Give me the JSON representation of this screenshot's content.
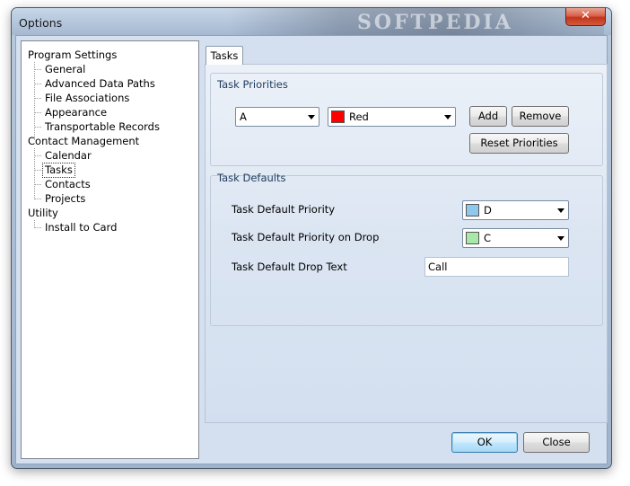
{
  "window": {
    "title": "Options",
    "close_glyph": "✕",
    "watermark": "SOFTPEDIA"
  },
  "tree": {
    "items": [
      {
        "label": "Program Settings",
        "level": 0
      },
      {
        "label": "General",
        "level": 1
      },
      {
        "label": "Advanced Data Paths",
        "level": 1
      },
      {
        "label": "File Associations",
        "level": 1
      },
      {
        "label": "Appearance",
        "level": 1
      },
      {
        "label": "Transportable Records",
        "level": 1
      },
      {
        "label": "Contact Management",
        "level": 0
      },
      {
        "label": "Calendar",
        "level": 1
      },
      {
        "label": "Tasks",
        "level": 1,
        "selected": true
      },
      {
        "label": "Contacts",
        "level": 1
      },
      {
        "label": "Projects",
        "level": 1
      },
      {
        "label": "Utility",
        "level": 0
      },
      {
        "label": "Install to Card",
        "level": 1
      }
    ]
  },
  "tabs": [
    {
      "label": "Tasks",
      "active": true
    }
  ],
  "task_priorities": {
    "group_label": "Task Priorities",
    "priority_value": "A",
    "color_value": "Red",
    "color_swatch": "#ff0000",
    "add_label": "Add",
    "remove_label": "Remove",
    "reset_label": "Reset Priorities"
  },
  "task_defaults": {
    "group_label": "Task Defaults",
    "default_priority_label": "Task Default Priority",
    "default_priority_value": "D",
    "default_priority_swatch": "#8fc8ec",
    "drop_priority_label": "Task Default Priority on Drop",
    "drop_priority_value": "C",
    "drop_priority_swatch": "#a8e8a8",
    "drop_text_label": "Task Default Drop Text",
    "drop_text_value": "Call"
  },
  "footer": {
    "ok_label": "OK",
    "close_label": "Close"
  }
}
